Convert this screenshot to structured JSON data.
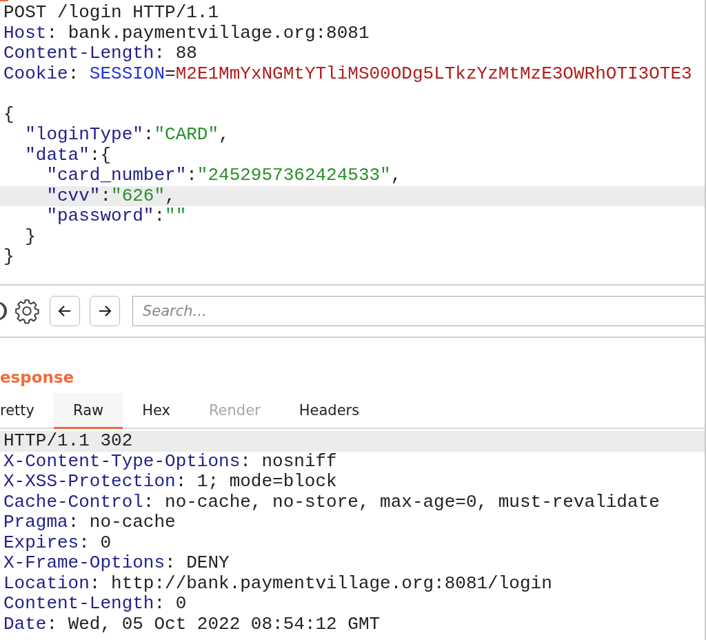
{
  "request": {
    "lines": [
      {
        "current": false,
        "tokens": [
          {
            "kind": "plain",
            "text": "POST /login HTTP/1.1"
          }
        ]
      },
      {
        "current": false,
        "tokens": [
          {
            "kind": "key",
            "text": "Host"
          },
          {
            "kind": "plain",
            "text": ": bank.paymentvillage.org:8081"
          }
        ]
      },
      {
        "current": false,
        "tokens": [
          {
            "kind": "key",
            "text": "Content-Length"
          },
          {
            "kind": "plain",
            "text": ": 88"
          }
        ]
      },
      {
        "current": false,
        "tokens": [
          {
            "kind": "key",
            "text": "Cookie"
          },
          {
            "kind": "plain",
            "text": ": "
          },
          {
            "kind": "attr",
            "text": "SESSION"
          },
          {
            "kind": "plain",
            "text": "="
          },
          {
            "kind": "value",
            "text": "M2E1MmYxNGMtYTliMS00ODg5LTkzYzMtMzE3OWRhOTI3OTE3"
          }
        ]
      },
      {
        "current": false
      },
      {
        "current": false,
        "tokens": [
          {
            "kind": "plain",
            "text": "{"
          }
        ]
      },
      {
        "current": false,
        "tokens": [
          {
            "kind": "key",
            "text": "  \"loginType\""
          },
          {
            "kind": "plain",
            "text": ":"
          },
          {
            "kind": "string",
            "text": "\"CARD\""
          },
          {
            "kind": "plain",
            "text": ","
          }
        ]
      },
      {
        "current": false,
        "tokens": [
          {
            "kind": "key",
            "text": "  \"data\""
          },
          {
            "kind": "plain",
            "text": ":{"
          }
        ]
      },
      {
        "current": false,
        "tokens": [
          {
            "kind": "key",
            "text": "    \"card_number\""
          },
          {
            "kind": "plain",
            "text": ":"
          },
          {
            "kind": "string",
            "text": "\"2452957362424533\""
          },
          {
            "kind": "plain",
            "text": ","
          }
        ]
      },
      {
        "current": true,
        "tokens": [
          {
            "kind": "key",
            "text": "    \"cvv\""
          },
          {
            "kind": "plain",
            "text": ":"
          },
          {
            "kind": "string",
            "text": "\"626\""
          },
          {
            "kind": "plain",
            "text": ","
          }
        ]
      },
      {
        "current": false,
        "tokens": [
          {
            "kind": "key",
            "text": "    \"password\""
          },
          {
            "kind": "plain",
            "text": ":"
          },
          {
            "kind": "string",
            "text": "\"\""
          }
        ]
      },
      {
        "current": false,
        "tokens": [
          {
            "kind": "plain",
            "text": "  }"
          }
        ]
      },
      {
        "current": false,
        "tokens": [
          {
            "kind": "plain",
            "text": "}"
          }
        ]
      }
    ]
  },
  "search": {
    "placeholder": "Search..."
  },
  "response": {
    "title": "esponse",
    "tabs": [
      {
        "label": "retty",
        "selected": false,
        "disabled": false
      },
      {
        "label": "Raw",
        "selected": true,
        "disabled": false
      },
      {
        "label": "Hex",
        "selected": false,
        "disabled": false
      },
      {
        "label": "Render",
        "selected": false,
        "disabled": true
      },
      {
        "label": "Headers",
        "selected": false,
        "disabled": false
      }
    ],
    "lines": [
      {
        "current": true,
        "tokens": [
          {
            "kind": "plain",
            "text": "HTTP/1.1 302"
          }
        ]
      },
      {
        "current": false,
        "tokens": [
          {
            "kind": "key",
            "text": "X-Content-Type-Options"
          },
          {
            "kind": "plain",
            "text": ": nosniff"
          }
        ]
      },
      {
        "current": false,
        "tokens": [
          {
            "kind": "key",
            "text": "X-XSS-Protection"
          },
          {
            "kind": "plain",
            "text": ": 1; mode=block"
          }
        ]
      },
      {
        "current": false,
        "tokens": [
          {
            "kind": "key",
            "text": "Cache-Control"
          },
          {
            "kind": "plain",
            "text": ": no-cache, no-store, max-age=0, must-revalidate"
          }
        ]
      },
      {
        "current": false,
        "tokens": [
          {
            "kind": "key",
            "text": "Pragma"
          },
          {
            "kind": "plain",
            "text": ": no-cache"
          }
        ]
      },
      {
        "current": false,
        "tokens": [
          {
            "kind": "key",
            "text": "Expires"
          },
          {
            "kind": "plain",
            "text": ": 0"
          }
        ]
      },
      {
        "current": false,
        "tokens": [
          {
            "kind": "key",
            "text": "X-Frame-Options"
          },
          {
            "kind": "plain",
            "text": ": DENY"
          }
        ]
      },
      {
        "current": false,
        "tokens": [
          {
            "kind": "key",
            "text": "Location"
          },
          {
            "kind": "plain",
            "text": ": http://bank.paymentvillage.org:8081/login"
          }
        ]
      },
      {
        "current": false,
        "tokens": [
          {
            "kind": "key",
            "text": "Content-Length"
          },
          {
            "kind": "plain",
            "text": ": 0"
          }
        ]
      },
      {
        "current": false,
        "tokens": [
          {
            "kind": "key",
            "text": "Date"
          },
          {
            "kind": "plain",
            "text": ": Wed, 05 Oct 2022 08:54:12 GMT"
          }
        ]
      }
    ]
  }
}
